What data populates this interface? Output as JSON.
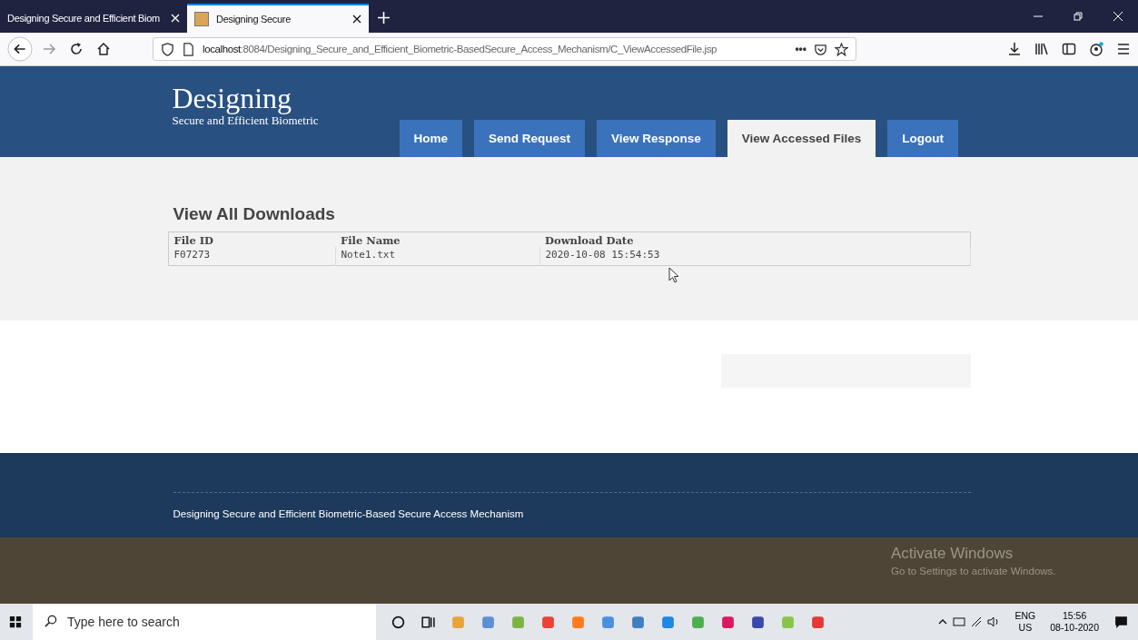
{
  "browser": {
    "tabs": [
      {
        "title": "Designing Secure and Efficient Biom",
        "selected": false
      },
      {
        "title": "Designing Secure",
        "selected": true
      }
    ],
    "url_host": "localhost",
    "url_path": ":8084/Designing_Secure_and_Efficient_Biometric-BasedSecure_Access_Mechanism/C_ViewAccessedFile.jsp",
    "page_actions": "•••"
  },
  "site": {
    "title": "Designing",
    "subtitle": "Secure and Efficient Biometric",
    "nav": [
      {
        "label": "Home",
        "selected": false
      },
      {
        "label": "Send Request",
        "selected": false
      },
      {
        "label": "View Response",
        "selected": false
      },
      {
        "label": "View Accessed Files",
        "selected": true
      },
      {
        "label": "Logout",
        "selected": false
      }
    ]
  },
  "downloads": {
    "heading": "View All Downloads",
    "columns": [
      "File ID",
      "File Name",
      "Download Date"
    ],
    "rows": [
      [
        "F07273",
        "Note1.txt",
        "2020-10-08 15:54:53"
      ]
    ]
  },
  "footer": {
    "text": "Designing Secure and Efficient Biometric-Based Secure Access Mechanism"
  },
  "activation": {
    "title": "Activate Windows",
    "message": "Go to Settings to activate Windows."
  },
  "taskbar": {
    "search_placeholder": "Type here to search",
    "language": "ENG",
    "region": "US",
    "time": "15:56",
    "date": "08-10-2020"
  }
}
